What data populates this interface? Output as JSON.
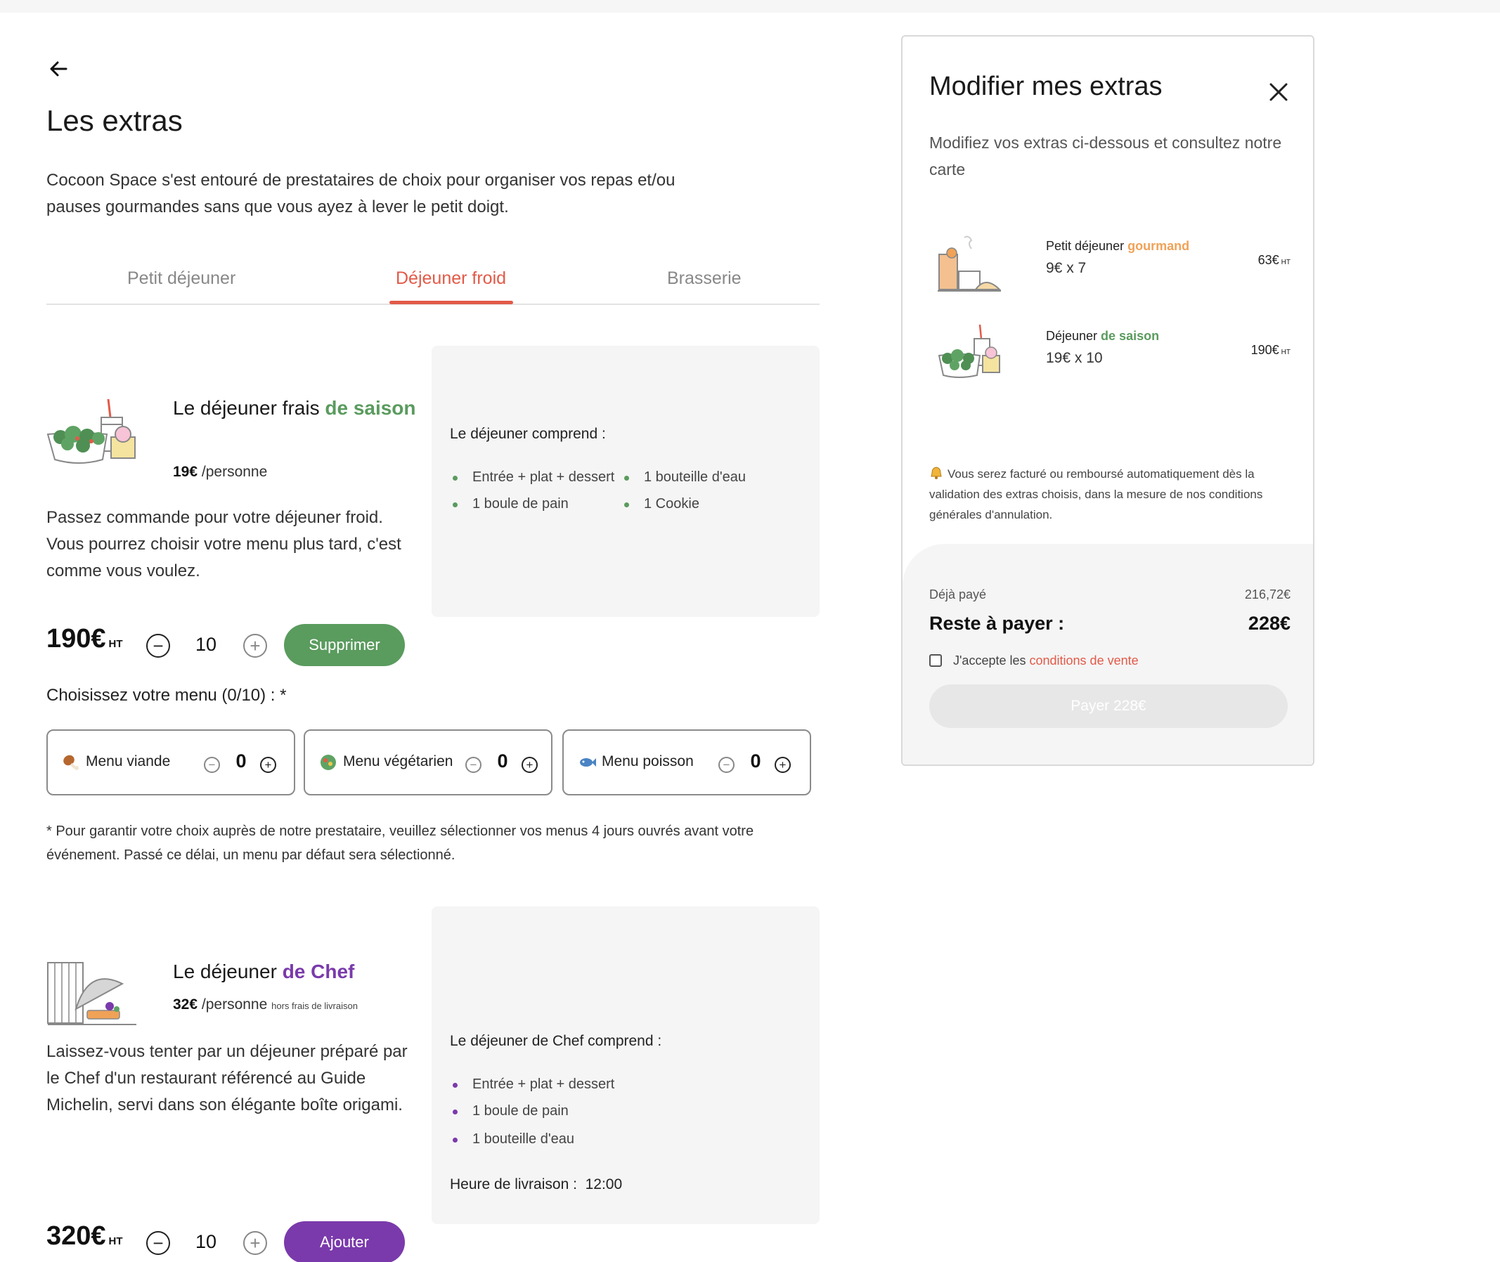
{
  "page": {
    "title": "Les extras",
    "intro": "Cocoon Space s'est entouré de prestataires de choix pour organiser vos repas et/ou pauses gourmandes sans que vous ayez à lever le petit doigt."
  },
  "tabs": [
    {
      "label": "Petit déjeuner",
      "active": false
    },
    {
      "label": "Déjeuner froid",
      "active": true
    },
    {
      "label": "Brasserie",
      "active": false
    }
  ],
  "product1": {
    "title_main": "Le déjeuner frais ",
    "title_highlight": "de saison",
    "unit_price": "19€",
    "per": " /personne",
    "description": "Passez commande pour votre déjeuner froid. Vous pourrez choisir votre menu plus tard, c'est comme vous voulez.",
    "total": "190€",
    "ht": "HT",
    "quantity": "10",
    "button_label": "Supprimer",
    "includes_title": "Le déjeuner comprend :",
    "includes": [
      "Entrée + plat + dessert",
      "1 bouteille d'eau",
      "1 boule de pain",
      "1 Cookie"
    ]
  },
  "menu_choice": {
    "label": "Choisissez votre menu (0/10) : *",
    "options": [
      {
        "label": "Menu viande",
        "icon": "drumstick-icon",
        "count": "0"
      },
      {
        "label": "Menu végétarien",
        "icon": "salad-icon",
        "count": "0"
      },
      {
        "label": "Menu poisson",
        "icon": "fish-icon",
        "count": "0"
      }
    ],
    "footnote": "* Pour garantir votre choix auprès de notre prestataire, veuillez sélectionner vos menus 4 jours ouvrés avant votre événement. Passé ce délai, un menu par défaut sera sélectionné."
  },
  "product2": {
    "title_main": "Le déjeuner ",
    "title_highlight": "de Chef",
    "unit_price": "32€",
    "per": " /personne",
    "note": "hors frais de livraison",
    "description": "Laissez-vous tenter par un déjeuner préparé par le Chef d'un restaurant référencé au Guide Michelin, servi dans son élégante boîte origami.",
    "total": "320€",
    "ht": "HT",
    "quantity": "10",
    "button_label": "Ajouter",
    "includes_title": "Le déjeuner de Chef comprend :",
    "includes": [
      "Entrée + plat + dessert",
      "1 boule de pain",
      "1 bouteille d'eau"
    ],
    "delivery_label": "Heure de livraison :",
    "delivery_time": "12:00"
  },
  "panel": {
    "title": "Modifier mes extras",
    "subtitle": "Modifiez vos extras ci-dessous et consultez notre carte",
    "items": [
      {
        "name": "Petit déjeuner ",
        "highlight": "gourmand",
        "qty": "9€ x 7",
        "price": "63€",
        "ht": "HT"
      },
      {
        "name": "Déjeuner ",
        "highlight": "de saison",
        "qty": "19€ x 10",
        "price": "190€",
        "ht": "HT"
      }
    ],
    "notice": "Vous serez facturé ou remboursé automatiquement dès la validation des extras choisis, dans la mesure de nos conditions générales d'annulation.",
    "paid_label": "Déjà payé",
    "paid_value": "216,72€",
    "remaining_label": "Reste à payer :",
    "remaining_value": "228€",
    "accept_text": "J'accepte les ",
    "accept_link": "conditions de vente",
    "pay_button": "Payer 228€"
  },
  "colors": {
    "accent_red": "#e25a48",
    "green": "#5a9b5e",
    "purple": "#7a3aab",
    "orange": "#f0a257"
  }
}
